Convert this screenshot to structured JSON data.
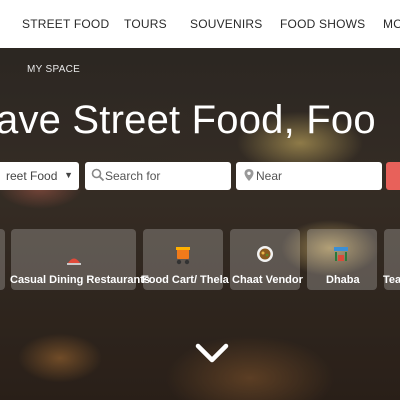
{
  "nav": {
    "items": [
      {
        "label": "STREET FOOD"
      },
      {
        "label": "TOURS"
      },
      {
        "label": "SOUVENIRS"
      },
      {
        "label": "FOOD SHOWS"
      },
      {
        "label": "MO"
      }
    ]
  },
  "hero": {
    "my_space": "MY SPACE",
    "headline": "ave Street Food, Foo"
  },
  "search": {
    "category_value": "reet Food",
    "search_placeholder": "Search for",
    "near_placeholder": "Near"
  },
  "categories": [
    {
      "label": "Casual Dining Restaurants",
      "icon": "restaurant-icon"
    },
    {
      "label": "Food Cart/ Thela",
      "icon": "food-cart-icon"
    },
    {
      "label": "Chaat Vendor",
      "icon": "chaat-bowl-icon"
    },
    {
      "label": "Dhaba",
      "icon": "dhaba-icon"
    },
    {
      "label": "Tea",
      "icon": "tea-icon"
    }
  ],
  "colors": {
    "accent": "#e8615a",
    "cart_orange": "#f07a1a"
  }
}
